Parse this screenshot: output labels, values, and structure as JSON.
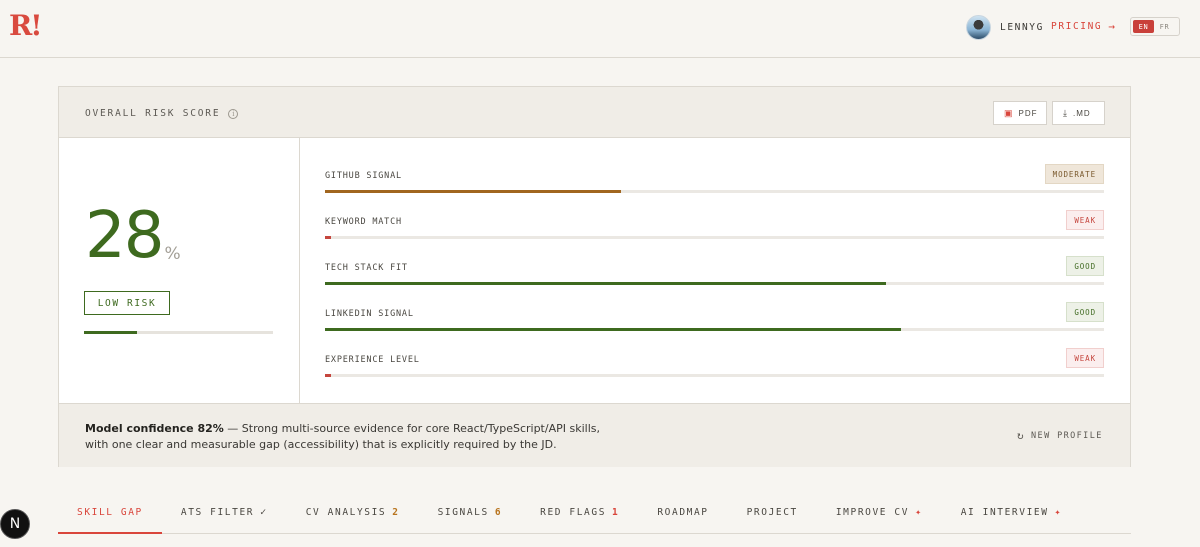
{
  "header": {
    "logo_text": "R!",
    "user_name": "LENNYG",
    "pricing_label": "PRICING",
    "pricing_arrow": "→",
    "lang_options": [
      "EN",
      "FR"
    ],
    "lang_selected": "EN"
  },
  "risk_card": {
    "title": "OVERALL RISK SCORE",
    "info_glyph": "i",
    "export_buttons": [
      {
        "label": "PDF",
        "icon": "pdf-icon"
      },
      {
        "label": ".MD",
        "icon": "download-icon"
      }
    ],
    "score_value": "28",
    "score_unit": "%",
    "risk_label": "LOW RISK",
    "score_fraction": 0.28,
    "signals": [
      {
        "label": "GITHUB SIGNAL",
        "status": "MODERATE",
        "level": 0.38,
        "color": "#a1661f"
      },
      {
        "label": "KEYWORD MATCH",
        "status": "WEAK",
        "level": 0.008,
        "color": "#c5463e"
      },
      {
        "label": "TECH STACK FIT",
        "status": "GOOD",
        "level": 0.72,
        "color": "#3e6a1f"
      },
      {
        "label": "LINKEDIN SIGNAL",
        "status": "GOOD",
        "level": 0.74,
        "color": "#3e6a1f"
      },
      {
        "label": "EXPERIENCE LEVEL",
        "status": "WEAK",
        "level": 0.008,
        "color": "#c5463e"
      }
    ],
    "confidence_label": "Model confidence 82%",
    "confidence_text": " — Strong multi-source evidence for core React/TypeScript/API skills, with one clear and measurable gap (accessibility) that is explicitly required by the JD.",
    "new_profile_label": "NEW PROFILE"
  },
  "tabs": [
    {
      "label": "SKILL GAP",
      "active": true
    },
    {
      "label": "ATS FILTER",
      "mark": "✓"
    },
    {
      "label": "CV ANALYSIS",
      "count": "2",
      "count_color": "orange"
    },
    {
      "label": "SIGNALS",
      "count": "6",
      "count_color": "orange"
    },
    {
      "label": "RED FLAGS",
      "count": "1",
      "count_color": "red"
    },
    {
      "label": "ROADMAP"
    },
    {
      "label": "PROJECT"
    },
    {
      "label": "IMPROVE CV",
      "mark": "✦",
      "mark_color": "red"
    },
    {
      "label": "AI INTERVIEW",
      "mark": "✦",
      "mark_color": "red"
    }
  ],
  "dev_badge": "N",
  "colors": {
    "accent": "#d9453b",
    "good": "#3e6a1f",
    "moderate": "#a1661f"
  }
}
